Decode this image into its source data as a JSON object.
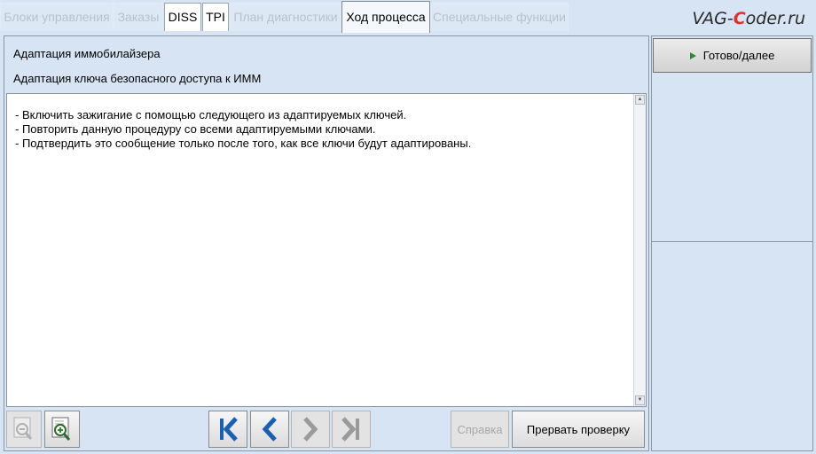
{
  "tabs": [
    {
      "label": "Блоки управления",
      "state": "disabled"
    },
    {
      "label": "Заказы",
      "state": "disabled"
    },
    {
      "label": "DISS",
      "state": "enabled"
    },
    {
      "label": "TPI",
      "state": "enabled"
    },
    {
      "label": "План диагностики",
      "state": "disabled"
    },
    {
      "label": "Ход процесса",
      "state": "active"
    },
    {
      "label": "Специальные функции",
      "state": "disabled"
    }
  ],
  "watermark": {
    "part1": "VAG-",
    "part2": "C",
    "part3": "oder.ru"
  },
  "header": {
    "title": "Адаптация иммобилайзера",
    "subtitle": "Адаптация ключа безопасного доступа к ИММ"
  },
  "instructions": [
    "- Включить зажигание с помощью следующего из адаптируемых ключей.",
    "- Повторить данную процедуру со всеми адаптируемыми ключами.",
    "- Подтвердить это сообщение только после того, как все ключи будут адаптированы."
  ],
  "toolbar": {
    "help_label": "Справка",
    "abort_label": "Прервать проверку"
  },
  "right_panel": {
    "next_label": "Готово/далее"
  },
  "icons": {
    "zoom_out": "zoom-out-icon",
    "zoom_in": "zoom-in-icon",
    "first": "first-page-icon",
    "prev": "prev-page-icon",
    "next": "next-page-icon",
    "last": "last-page-icon",
    "play": "play-icon"
  },
  "colors": {
    "background": "#d6e4f4",
    "nav_active": "#1a5fb4",
    "nav_disabled": "#9a9a9a",
    "play": "#2e8b2e",
    "watermark_accent": "#e0302a"
  }
}
